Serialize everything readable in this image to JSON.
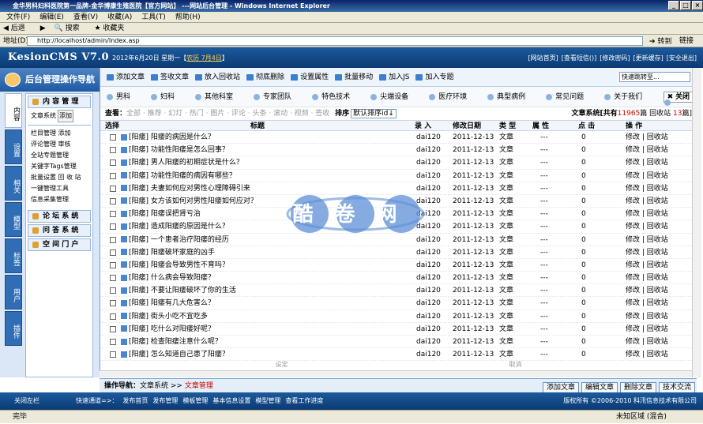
{
  "browser": {
    "title": "金华男科妇科医院第一品牌-金华博康生殖医院【官方网站】 ---网站后台管理 - Windows Internet Explorer",
    "menu": [
      "文件(F)",
      "编辑(E)",
      "查看(V)",
      "收藏(A)",
      "工具(T)",
      "帮助(H)"
    ],
    "toolbar": [
      "后退",
      "搜索",
      "收藏夹"
    ],
    "address_label": "地址(D)",
    "url": "http://localhost/admin/Index.asp",
    "go": "转到",
    "links": "链接",
    "status": "完毕",
    "zone": "未知区域 (混合)"
  },
  "header": {
    "logo": "KesionCMS V7.0",
    "date": "2012年6月20日 星期一【",
    "lunar": "农历 7月4日",
    "date_end": "】",
    "links": [
      "[网站首页]",
      "[查看短信()]",
      "[修改密码]",
      "[更新缓存]",
      "[安全退出]"
    ]
  },
  "sidebar": {
    "title": "后台管理操作导航",
    "tabs": [
      "内容",
      "设置",
      "相关",
      "模型",
      "标签",
      "用户",
      "插件"
    ],
    "head": "内 容 管 理",
    "item0": "文章系统",
    "add": "添加",
    "items": [
      "栏目管理 添加",
      "评论管理 审核",
      "全站专题管理",
      "关键字Tags管理",
      "批量设置 回 收 站",
      "一键管理工具",
      "信息采集管理"
    ],
    "sections": [
      "论 坛 系 统",
      "问 答 系 统",
      "空 间 门 户"
    ]
  },
  "toolbar1": {
    "items": [
      "添加文章",
      "签收文章",
      "放入回收站",
      "彻底删除",
      "设置属性",
      "批量移动",
      "加入JS",
      "加入专题"
    ],
    "jump": "快速跳转至..."
  },
  "toolbar2": {
    "items": [
      "男科",
      "妇科",
      "其他科室",
      "专家团队",
      "特色技术",
      "尖端设备",
      "医疗环境",
      "典型病例",
      "常见问题",
      "关于我们"
    ],
    "close": "关闭"
  },
  "filter": {
    "label": "查看：",
    "options": "全部 · 推荐 · 幻灯 · 热门 · 图片 · 评论 · 头条 · 滚动 · 视频 · 签收",
    "sort_label": "排序",
    "sort": "默认排序id↓",
    "stat1": "文章系统[共有",
    "count": "11965",
    "stat2": "篇 回收站",
    "recycle": "13",
    "stat3": "篇]"
  },
  "table": {
    "headers": [
      "选择",
      "标题",
      "录 入",
      "修改日期",
      "类 型",
      "属 性",
      "点 击",
      "操 作"
    ],
    "rows": [
      [
        "[阳痿] 阳痿的病因是什么？",
        "dai120",
        "2011-12-13",
        "文章",
        "---",
        "0",
        "修改 | 回收站"
      ],
      [
        "[阳痿] 功能性阳痿是怎么回事？",
        "dai120",
        "2011-12-13",
        "文章",
        "---",
        "0",
        "修改 | 回收站"
      ],
      [
        "[阳痿] 男人阳痿的初期症状是什么？",
        "dai120",
        "2011-12-13",
        "文章",
        "---",
        "0",
        "修改 | 回收站"
      ],
      [
        "[阳痿] 功能性阳痿的病因有哪些？",
        "dai120",
        "2011-12-13",
        "文章",
        "---",
        "0",
        "修改 | 回收站"
      ],
      [
        "[阳痿] 夫妻如何应对男性心理障碍引来",
        "dai120",
        "2011-12-13",
        "文章",
        "---",
        "0",
        "修改 | 回收站"
      ],
      [
        "[阳痿] 女方该如何对男性阳痿如何应对？",
        "dai120",
        "2011-12-13",
        "文章",
        "---",
        "0",
        "修改 | 回收站"
      ],
      [
        "[阳痿] 阳痿误把肾亏治",
        "dai120",
        "2011-12-13",
        "文章",
        "---",
        "0",
        "修改 | 回收站"
      ],
      [
        "[阳痿] 造成阳痿的原因是什么？",
        "dai120",
        "2011-12-13",
        "文章",
        "---",
        "0",
        "修改 | 回收站"
      ],
      [
        "[阳痿] 一个患者治疗阳痿的经历",
        "dai120",
        "2011-12-13",
        "文章",
        "---",
        "0",
        "修改 | 回收站"
      ],
      [
        "[阳痿] 阳痿破坏家庭的凶手",
        "dai120",
        "2011-12-13",
        "文章",
        "---",
        "0",
        "修改 | 回收站"
      ],
      [
        "[阳痿] 阳痿会导致男性不育吗？",
        "dai120",
        "2011-12-13",
        "文章",
        "---",
        "0",
        "修改 | 回收站"
      ],
      [
        "[阳痿] 什么病会导致阳痿？",
        "dai120",
        "2011-12-13",
        "文章",
        "---",
        "0",
        "修改 | 回收站"
      ],
      [
        "[阳痿] 不要让阳痿破坏了你的生活",
        "dai120",
        "2011-12-13",
        "文章",
        "---",
        "0",
        "修改 | 回收站"
      ],
      [
        "[阳痿] 阳痿有几大危害么？",
        "dai120",
        "2011-12-13",
        "文章",
        "---",
        "0",
        "修改 | 回收站"
      ],
      [
        "[阳痿] 街头小吃不宜吃多",
        "dai120",
        "2011-12-13",
        "文章",
        "---",
        "0",
        "修改 | 回收站"
      ],
      [
        "[阳痿] 吃什么对阳痿好呢？",
        "dai120",
        "2011-12-13",
        "文章",
        "---",
        "0",
        "修改 | 回收站"
      ],
      [
        "[阳痿] 检查阳痿注意什么呢？",
        "dai120",
        "2011-12-13",
        "文章",
        "---",
        "0",
        "修改 | 回收站"
      ],
      [
        "[阳痿] 怎么知道自己患了阳痿？",
        "dai120",
        "2011-12-13",
        "文章",
        "---",
        "0",
        "修改 | 回收站"
      ]
    ],
    "cut_left": "设定",
    "cut_right": "取消"
  },
  "bottomnav": {
    "label": "操作导航：",
    "path": "文章系统 >> ",
    "current": "文章管理",
    "buttons": [
      "添加文章",
      "编辑文章",
      "删除文章",
      "技术交流"
    ]
  },
  "footer": {
    "close": "关闭左栏",
    "quick_label": "快速通道=>：",
    "quick": [
      "发布首页",
      "发布管理",
      "模板管理",
      "基本信息设置",
      "模型管理",
      "查看工作进度"
    ],
    "copyright": "版权所有 ©2006-2010 科汛信息技术有限公司"
  },
  "watermark": "酷卷网",
  "colors": {
    "header": "#1c5a9c",
    "accent_red": "#cc0000"
  }
}
